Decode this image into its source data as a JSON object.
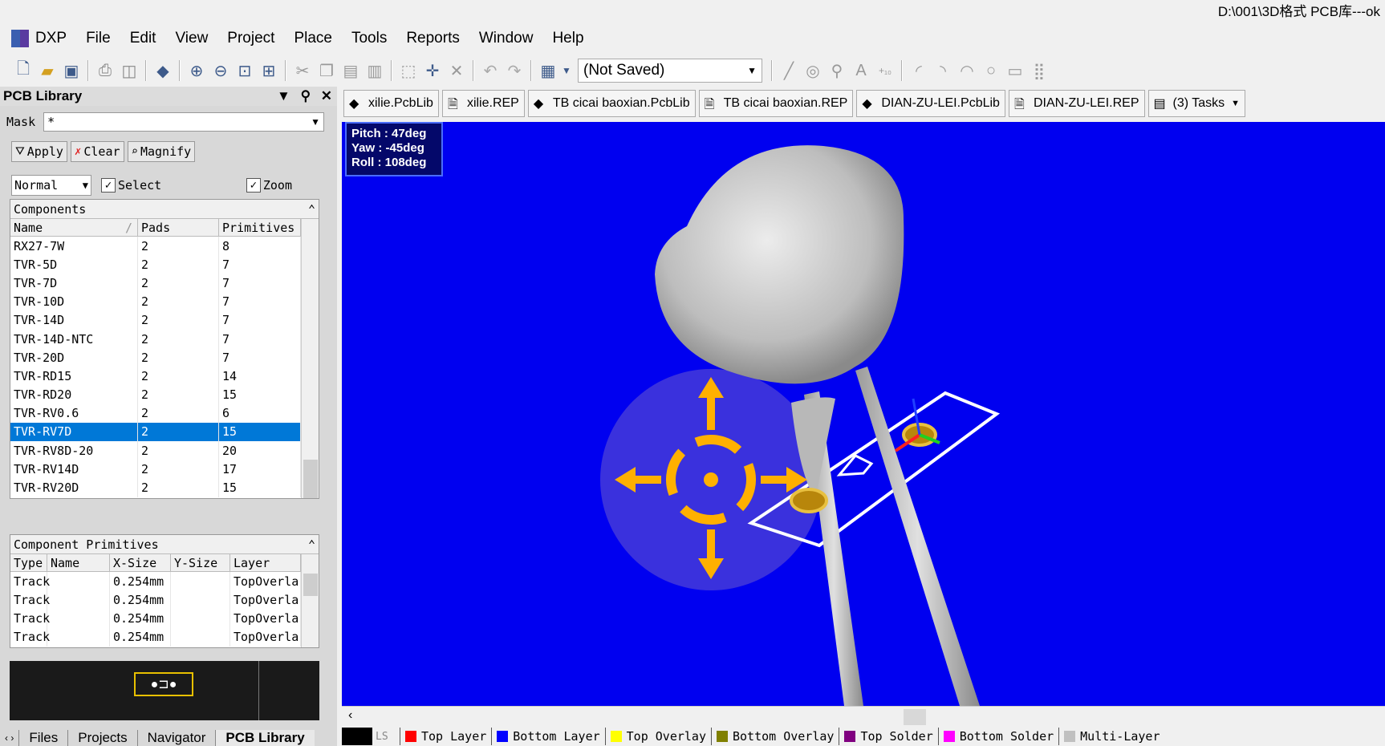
{
  "title_path": "D:\\001\\3D格式 PCB库---ok",
  "menu": [
    "DXP",
    "File",
    "Edit",
    "View",
    "Project",
    "Place",
    "Tools",
    "Reports",
    "Window",
    "Help"
  ],
  "toolbar": {
    "layer_value": "(Not Saved)"
  },
  "panel": {
    "title": "PCB Library",
    "mask_label": "Mask",
    "mask_value": "*",
    "apply": "Apply",
    "clear": "Clear",
    "magnify": "Magnify",
    "mode": "Normal",
    "select": "Select",
    "zoom": "Zoom",
    "components_title": "Components",
    "components_cols": [
      "Name",
      "Pads",
      "Primitives"
    ],
    "components": [
      [
        "RX27-7W",
        "2",
        "8"
      ],
      [
        "TVR-5D",
        "2",
        "7"
      ],
      [
        "TVR-7D",
        "2",
        "7"
      ],
      [
        "TVR-10D",
        "2",
        "7"
      ],
      [
        "TVR-14D",
        "2",
        "7"
      ],
      [
        "TVR-14D-NTC",
        "2",
        "7"
      ],
      [
        "TVR-20D",
        "2",
        "7"
      ],
      [
        "TVR-RD15",
        "2",
        "14"
      ],
      [
        "TVR-RD20",
        "2",
        "15"
      ],
      [
        "TVR-RV0.6",
        "2",
        "6"
      ],
      [
        "TVR-RV7D",
        "2",
        "15"
      ],
      [
        "TVR-RV8D-20",
        "2",
        "20"
      ],
      [
        "TVR-RV14D",
        "2",
        "17"
      ],
      [
        "TVR-RV20D",
        "2",
        "15"
      ]
    ],
    "selected_index": 10,
    "primitives_title": "Component Primitives",
    "primitives_cols": [
      "Type",
      "Name",
      "X-Size",
      "Y-Size",
      "Layer"
    ],
    "primitives": [
      [
        "Track",
        "",
        "0.254mm",
        "",
        "TopOverla"
      ],
      [
        "Track",
        "",
        "0.254mm",
        "",
        "TopOverla"
      ],
      [
        "Track",
        "",
        "0.254mm",
        "",
        "TopOverla"
      ],
      [
        "Track",
        "",
        "0.254mm",
        "",
        "TopOverla"
      ]
    ],
    "tabs": [
      "Files",
      "Projects",
      "Navigator",
      "PCB Library"
    ]
  },
  "doc_tabs": [
    {
      "label": "xilie.PcbLib",
      "icon": "pcblib-icon"
    },
    {
      "label": "xilie.REP",
      "icon": "report-icon"
    },
    {
      "label": "TB cicai baoxian.PcbLib",
      "icon": "pcblib-icon"
    },
    {
      "label": "TB cicai baoxian.REP",
      "icon": "report-icon"
    },
    {
      "label": "DIAN-ZU-LEI.PcbLib",
      "icon": "pcblib-icon"
    },
    {
      "label": "DIAN-ZU-LEI.REP",
      "icon": "report-icon"
    },
    {
      "label": "(3) Tasks",
      "icon": "tasks-icon"
    }
  ],
  "view_angles": {
    "pitch": "Pitch : 47deg",
    "yaw": "Yaw : -45deg",
    "roll": "Roll : 108deg"
  },
  "layer_tabs": {
    "ls": "LS",
    "layers": [
      {
        "name": "Top Layer",
        "color": "#ff0000"
      },
      {
        "name": "Bottom Layer",
        "color": "#0000ff"
      },
      {
        "name": "Top Overlay",
        "color": "#ffff00"
      },
      {
        "name": "Bottom Overlay",
        "color": "#808000"
      },
      {
        "name": "Top Solder",
        "color": "#800080"
      },
      {
        "name": "Bottom Solder",
        "color": "#ff00ff"
      },
      {
        "name": "Multi-Layer",
        "color": "#c0c0c0"
      }
    ]
  },
  "colors": {
    "viewport_bg": "#0000f0",
    "selection": "#0078d7",
    "gizmo": "#ffb000"
  }
}
